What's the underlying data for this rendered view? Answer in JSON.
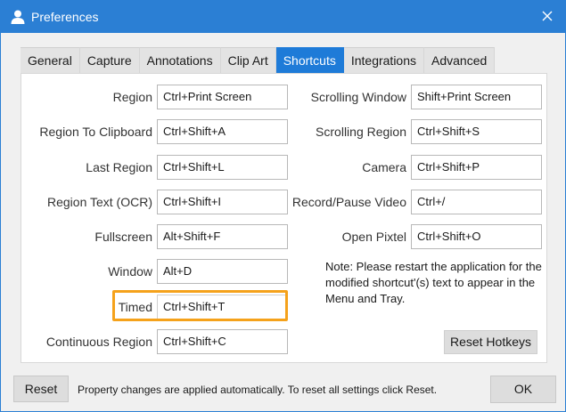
{
  "window": {
    "title": "Preferences",
    "accent_color": "#2b7fd4",
    "icon": "user-icon"
  },
  "tabs": [
    {
      "label": "General",
      "active": false
    },
    {
      "label": "Capture",
      "active": false
    },
    {
      "label": "Annotations",
      "active": false
    },
    {
      "label": "Clip Art",
      "active": false
    },
    {
      "label": "Shortcuts",
      "active": true
    },
    {
      "label": "Integrations",
      "active": false
    },
    {
      "label": "Advanced",
      "active": false
    }
  ],
  "shortcuts": {
    "left": [
      {
        "label": "Region",
        "value": "Ctrl+Print Screen"
      },
      {
        "label": "Region To Clipboard",
        "value": "Ctrl+Shift+A"
      },
      {
        "label": "Last Region",
        "value": "Ctrl+Shift+L"
      },
      {
        "label": "Region Text (OCR)",
        "value": "Ctrl+Shift+I"
      },
      {
        "label": "Fullscreen",
        "value": "Alt+Shift+F"
      },
      {
        "label": "Window",
        "value": "Alt+D"
      },
      {
        "label": "Timed",
        "value": "Ctrl+Shift+T"
      },
      {
        "label": "Continuous Region",
        "value": "Ctrl+Shift+C"
      }
    ],
    "right": [
      {
        "label": "Scrolling Window",
        "value": "Shift+Print Screen"
      },
      {
        "label": "Scrolling Region",
        "value": "Ctrl+Shift+S"
      },
      {
        "label": "Camera",
        "value": "Ctrl+Shift+P"
      },
      {
        "label": "Record/Pause Video",
        "value": "Ctrl+/"
      },
      {
        "label": "Open Pixtel",
        "value": "Ctrl+Shift+O"
      }
    ]
  },
  "highlight_color": "#f5a21b",
  "note": "Note: Please restart the application for the modified shortcut'(s) text to appear in the Menu and Tray.",
  "reset_hotkeys_label": "Reset Hotkeys",
  "footer": {
    "reset_label": "Reset",
    "message": "Property changes are applied automatically. To reset all settings click Reset.",
    "ok_label": "OK"
  }
}
